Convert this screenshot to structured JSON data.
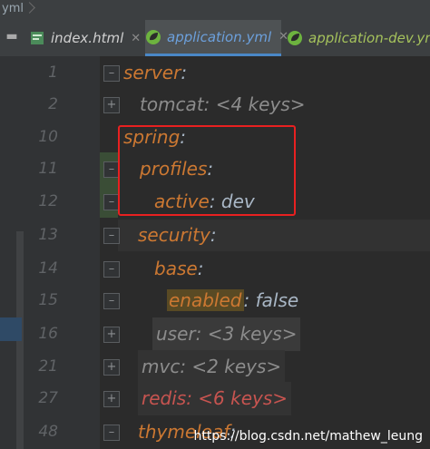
{
  "breadcrumb": {
    "file": "yml"
  },
  "tabs": [
    {
      "label": "index.html",
      "active": false
    },
    {
      "label": "application.yml",
      "active": true
    },
    {
      "label": "application-dev.yml",
      "active": false
    }
  ],
  "lines": [
    {
      "num": "1",
      "key": "server",
      "sep": ":",
      "value": ""
    },
    {
      "num": "2",
      "key": "",
      "sep": "",
      "value": "tomcat: <4 keys>"
    },
    {
      "num": "10",
      "key": "spring",
      "sep": ":",
      "value": ""
    },
    {
      "num": "11",
      "key": "profiles",
      "sep": ":",
      "value": ""
    },
    {
      "num": "12",
      "key": "active",
      "sep": ":",
      "value": "dev"
    },
    {
      "num": "13",
      "key": "security",
      "sep": ":",
      "value": ""
    },
    {
      "num": "14",
      "key": "base",
      "sep": ":",
      "value": ""
    },
    {
      "num": "15",
      "key": "enabled",
      "sep": ":",
      "value": "false"
    },
    {
      "num": "16",
      "key": "",
      "sep": "",
      "value": "user: <3 keys>"
    },
    {
      "num": "21",
      "key": "",
      "sep": "",
      "value": "mvc: <2 keys>"
    },
    {
      "num": "27",
      "key": "",
      "sep": "",
      "value": "redis: <6 keys>"
    },
    {
      "num": "48",
      "key": "thymeleaf",
      "sep": ":",
      "value": ""
    }
  ],
  "watermark": "https://blog.csdn.net/mathew_leung",
  "colors": {
    "key": "#cc7832",
    "value": "#a9b7c6",
    "highlight_box": "#e82020",
    "active_tab": "#6ca0dc"
  }
}
